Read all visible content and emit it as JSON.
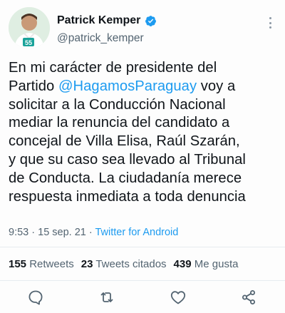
{
  "author": {
    "name": "Patrick Kemper",
    "handle": "@patrick_kemper",
    "verified": true,
    "avatar_badge": "55"
  },
  "tweet": {
    "lines": [
      {
        "before": "En mi carácter de presidente del",
        "mention": "",
        "after": ""
      },
      {
        "before": "Partido ",
        "mention": "@HagamosParaguay",
        "after": " voy a"
      },
      {
        "before": "solicitar a la Conducción Nacional",
        "mention": "",
        "after": ""
      },
      {
        "before": "mediar la renuncia del candidato a",
        "mention": "",
        "after": ""
      },
      {
        "before": "concejal de Villa Elisa, Raúl Szarán,",
        "mention": "",
        "after": ""
      },
      {
        "before": "y que su caso sea llevado al Tribunal",
        "mention": "",
        "after": ""
      },
      {
        "before": "de Conducta. La ciudadanía merece",
        "mention": "",
        "after": ""
      },
      {
        "before": "respuesta inmediata a toda denuncia",
        "mention": "",
        "after": ""
      }
    ]
  },
  "meta": {
    "time": "9:53",
    "separator": " · ",
    "date": "15 sep. 21",
    "source": "Twitter for Android"
  },
  "stats": {
    "retweets_count": "155",
    "retweets_label": "Retweets",
    "quotes_count": "23",
    "quotes_label": "Tweets citados",
    "likes_count": "439",
    "likes_label": "Me gusta"
  },
  "colors": {
    "accent": "#1d9bf0",
    "text": "#0f1419",
    "muted": "#536471"
  },
  "actions": [
    "reply-icon",
    "retweet-icon",
    "like-icon",
    "share-icon"
  ]
}
